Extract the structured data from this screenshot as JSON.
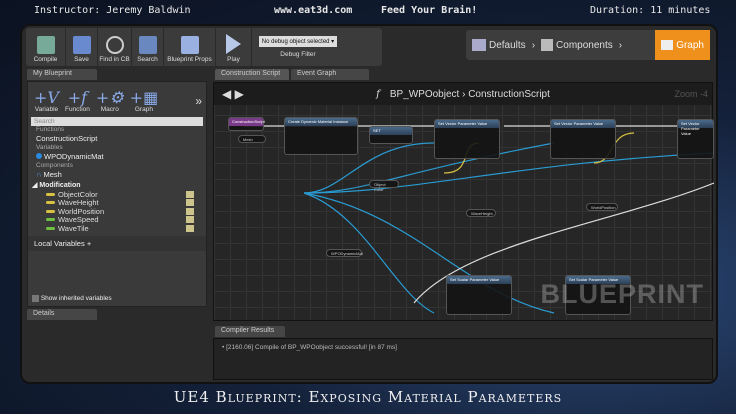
{
  "header": {
    "instructor": "Instructor: Jeremy Baldwin",
    "site": "www.eat3d.com",
    "slogan": "Feed Your Brain!",
    "duration": "Duration: 11 minutes"
  },
  "toolbar": {
    "compile": "Compile",
    "save": "Save",
    "find": "Find in CB",
    "search": "Search",
    "props": "Blueprint Props",
    "play": "Play",
    "debug_value": "No debug object selected ▾",
    "debug_label": "Debug Filter"
  },
  "modes": {
    "defaults": "Defaults",
    "components": "Components",
    "graph": "Graph"
  },
  "my_blueprint": {
    "tab": "My Blueprint",
    "add": [
      "Variable",
      "Function",
      "Macro",
      "Graph"
    ],
    "search_placeholder": "Search",
    "functions_label": "Functions",
    "function": "ConstructionScript",
    "variables_label": "Variables",
    "variable": "WPODynamicMat",
    "components_label": "Components",
    "component": "Mesh",
    "category": "Modification",
    "vars": [
      {
        "name": "ObjectColor",
        "color": "#d8c040"
      },
      {
        "name": "WaveHeight",
        "color": "#d8c040"
      },
      {
        "name": "WorldPosition",
        "color": "#d8c040"
      },
      {
        "name": "WaveSpeed",
        "color": "#70c040"
      },
      {
        "name": "WaveTile",
        "color": "#70c040"
      }
    ],
    "local_vars": "Local Variables",
    "show_inherited": "Show inherited variables"
  },
  "details_tab": "Details",
  "graph_tabs": [
    "Construction Script",
    "Event Graph"
  ],
  "graph": {
    "title": "BP_WPOobject",
    "subtitle": "ConstructionScript",
    "zoom": "Zoom -4",
    "watermark": "BLUEPRINT",
    "nodes": [
      "ConstructionScript",
      "Create Dynamic Material Instance",
      "SET",
      "Set Vector Parameter Value",
      "Set Vector Parameter Value",
      "Set Vector Parameter Value",
      "Set Scalar Parameter Value",
      "Set Scalar Parameter Value",
      "Mesh",
      "WPODynamicMat",
      "Object Color",
      "WaveHeight",
      "WorldPosition"
    ]
  },
  "compiler": {
    "tab": "Compiler Results",
    "message": "[2160.06] Compile of BP_WPOobject successful! [in 87 ms]"
  },
  "footer": {
    "title": "UE4 Blueprint: Exposing Material Parameters"
  }
}
